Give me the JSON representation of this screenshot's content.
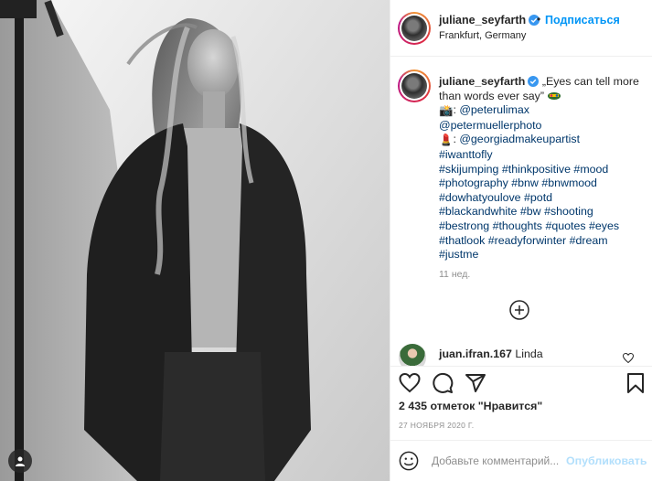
{
  "post": {
    "username": "juliane_seyfarth",
    "follow_label": "Подписаться",
    "location": "Frankfurt, Germany"
  },
  "caption": {
    "username": "juliane_seyfarth",
    "text_intro": "„Eyes can tell more than words ever say”",
    "photo_emoji": "📸",
    "mention_photographer": "@peterulimax",
    "mention_2": "@petermuellerphoto",
    "makeup_emoji": "💄",
    "mention_makeup": "@georgiadmakeupartist",
    "hashtags": [
      "#iwanttofly",
      "#skijumping",
      "#thinkpositive",
      "#mood",
      "#photography",
      "#bnw",
      "#bnwmood",
      "#dowhatyoulove",
      "#potd",
      "#blackandwhite",
      "#bw",
      "#shooting",
      "#bestrong",
      "#thoughts",
      "#quotes",
      "#eyes",
      "#thatlook",
      "#readyforwinter",
      "#dream",
      "#justme"
    ],
    "time_ago": "11 нед."
  },
  "first_comment": {
    "username": "juan.ifran.167",
    "text": "Linda"
  },
  "actions": {
    "icons": [
      "heart-icon",
      "comment-icon",
      "share-icon",
      "bookmark-icon"
    ],
    "likes_text": "2 435 отметок \"Нравится\"",
    "date_text": "27 НОЯБРЯ 2020 Г."
  },
  "comment_box": {
    "placeholder": "Добавьте комментарий...",
    "publish_label": "Опубликовать"
  },
  "colors": {
    "accent_blue": "#0095f6",
    "link_blue": "#00376b",
    "muted": "#8e8e8e",
    "publish_disabled": "#b2dffc"
  }
}
